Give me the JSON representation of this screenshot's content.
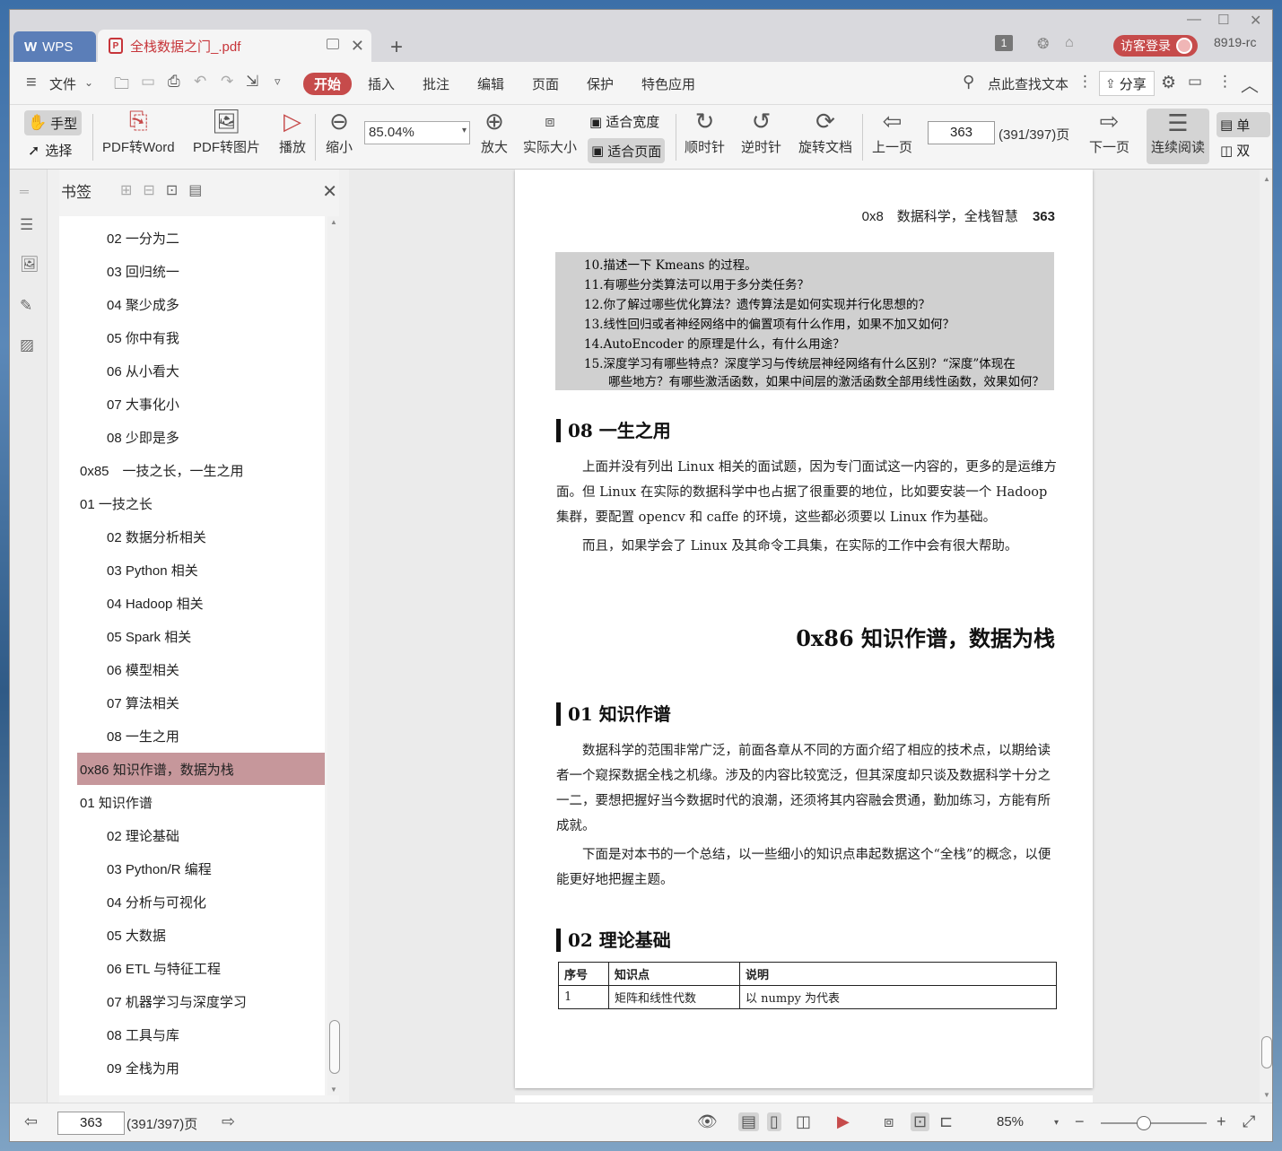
{
  "tabs": {
    "wps": "WPS",
    "doc": "全栈数据之门_.pdf",
    "pdf_badge": "P"
  },
  "top_right": {
    "badge": "1",
    "login": "访客登录",
    "version": "8919-rc"
  },
  "menu": {
    "file": "文件",
    "start": "开始",
    "insert": "插入",
    "annotate": "批注",
    "edit": "编辑",
    "page": "页面",
    "protect": "保护",
    "special": "特色应用",
    "search": "点此查找文本",
    "share": "分享"
  },
  "ribbon": {
    "hand": "手型",
    "select": "选择",
    "pdf_word": "PDF转Word",
    "pdf_img": "PDF转图片",
    "play": "播放",
    "zoom_out": "缩小",
    "zoom_value": "85.04%",
    "zoom_in": "放大",
    "actual": "实际大小",
    "fit_width": "适合宽度",
    "fit_page": "适合页面",
    "cw": "顺时针",
    "ccw": "逆时针",
    "rotate": "旋转文档",
    "prev": "上一页",
    "page": "363",
    "page_count": "(391/397)页",
    "next": "下一页",
    "continuous": "连续阅读",
    "single": "单",
    "double": "双"
  },
  "panel": {
    "title": "书签"
  },
  "bookmarks": [
    {
      "label": "02 一分为二",
      "level": 2
    },
    {
      "label": "03 回归统一",
      "level": 2
    },
    {
      "label": "04 聚少成多",
      "level": 2
    },
    {
      "label": "05 你中有我",
      "level": 2
    },
    {
      "label": "06 从小看大",
      "level": 2
    },
    {
      "label": "07 大事化小",
      "level": 2
    },
    {
      "label": "08 少即是多",
      "level": 2
    },
    {
      "label": "0x85　一技之长，一生之用",
      "level": 1
    },
    {
      "label": "01 一技之长",
      "level": 1
    },
    {
      "label": "02 数据分析相关",
      "level": 2
    },
    {
      "label": "03 Python 相关",
      "level": 2
    },
    {
      "label": "04 Hadoop 相关",
      "level": 2
    },
    {
      "label": "05 Spark 相关",
      "level": 2
    },
    {
      "label": "06 模型相关",
      "level": 2
    },
    {
      "label": "07 算法相关",
      "level": 2
    },
    {
      "label": "08 一生之用",
      "level": 2
    },
    {
      "label": "0x86 知识作谱，数据为栈",
      "level": 1,
      "active": true
    },
    {
      "label": "01 知识作谱",
      "level": 1
    },
    {
      "label": "02 理论基础",
      "level": 2
    },
    {
      "label": "03 Python/R 编程",
      "level": 2
    },
    {
      "label": "04 分析与可视化",
      "level": 2
    },
    {
      "label": "05 大数据",
      "level": 2
    },
    {
      "label": "06 ETL 与特征工程",
      "level": 2
    },
    {
      "label": "07 机器学习与深度学习",
      "level": 2
    },
    {
      "label": "08 工具与库",
      "level": 2
    },
    {
      "label": "09 全栈为用",
      "level": 2
    }
  ],
  "doc": {
    "header_left": "0x8　数据科学，全栈智慧",
    "header_page": "363",
    "questions": [
      "10.描述一下 Kmeans 的过程。",
      "11.有哪些分类算法可以用于多分类任务？",
      "12.你了解过哪些优化算法？遗传算法是如何实现并行化思想的？",
      "13.线性回归或者神经网络中的偏置项有什么作用，如果不加又如何？",
      "14.AutoEncoder 的原理是什么，有什么用途？",
      "15.深度学习有哪些特点？深度学习与传统层神经网络有什么区别？“深度”体现在",
      "　　哪些地方？有哪些激活函数，如果中间层的激活函数全部用线性函数，效果如何？"
    ],
    "h_08": "08 一生之用",
    "p_08a": "上面并没有列出 Linux 相关的面试题，因为专门面试这一内容的，更多的是运维方面。但 Linux 在实际的数据科学中也占据了很重要的地位，比如要安装一个 Hadoop 集群，要配置 opencv 和 caffe 的环境，这些都必须要以 Linux 作为基础。",
    "p_08b": "而且，如果学会了 Linux 及其命令工具集，在实际的工作中会有很大帮助。",
    "chapter": "0x86  知识作谱，数据为栈",
    "h_01": "01 知识作谱",
    "p_01a": "数据科学的范围非常广泛，前面各章从不同的方面介绍了相应的技术点，以期给读者一个窥探数据全栈之机缘。涉及的内容比较宽泛，但其深度却只谈及数据科学十分之一二，要想把握好当今数据时代的浪潮，还须将其内容融会贯通，勤加练习，方能有所成就。",
    "p_01b": "下面是对本书的一个总结，以一些细小的知识点串起数据这个“全栈”的概念，以便能更好地把握主题。",
    "h_02": "02 理论基础",
    "table_headers": [
      "序号",
      "知识点",
      "说明"
    ],
    "table_rows": [
      [
        "1",
        "矩阵和线性代数",
        "以 numpy 为代表"
      ]
    ]
  },
  "status": {
    "page": "363",
    "page_count": "(391/397)页",
    "zoom": "85%"
  }
}
